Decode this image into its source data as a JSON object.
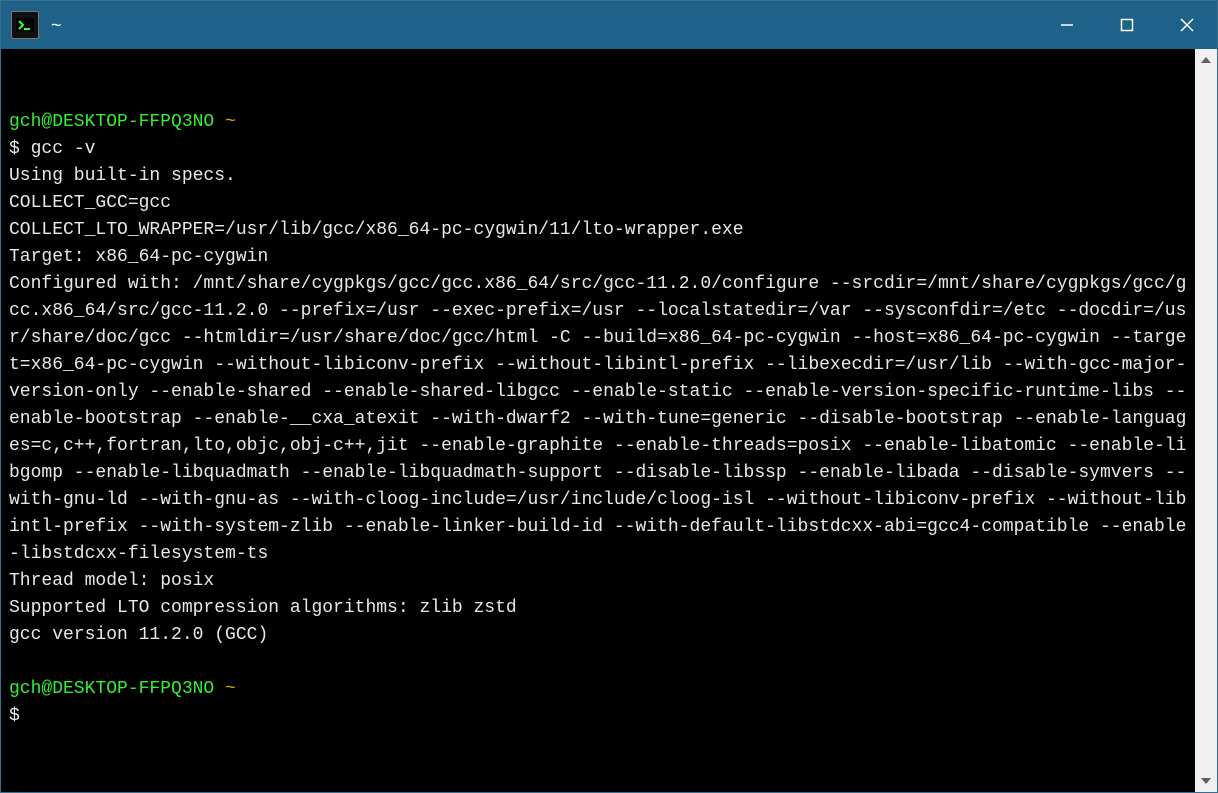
{
  "window": {
    "title": "~"
  },
  "terminal": {
    "prompt1_user": "gch@DESKTOP-FFPQ3NO",
    "prompt1_tilde": "~",
    "prompt1_symbol": "$ ",
    "command1": "gcc -v",
    "output": "Using built-in specs.\nCOLLECT_GCC=gcc\nCOLLECT_LTO_WRAPPER=/usr/lib/gcc/x86_64-pc-cygwin/11/lto-wrapper.exe\nTarget: x86_64-pc-cygwin\nConfigured with: /mnt/share/cygpkgs/gcc/gcc.x86_64/src/gcc-11.2.0/configure --srcdir=/mnt/share/cygpkgs/gcc/gcc.x86_64/src/gcc-11.2.0 --prefix=/usr --exec-prefix=/usr --localstatedir=/var --sysconfdir=/etc --docdir=/usr/share/doc/gcc --htmldir=/usr/share/doc/gcc/html -C --build=x86_64-pc-cygwin --host=x86_64-pc-cygwin --target=x86_64-pc-cygwin --without-libiconv-prefix --without-libintl-prefix --libexecdir=/usr/lib --with-gcc-major-version-only --enable-shared --enable-shared-libgcc --enable-static --enable-version-specific-runtime-libs --enable-bootstrap --enable-__cxa_atexit --with-dwarf2 --with-tune=generic --disable-bootstrap --enable-languages=c,c++,fortran,lto,objc,obj-c++,jit --enable-graphite --enable-threads=posix --enable-libatomic --enable-libgomp --enable-libquadmath --enable-libquadmath-support --disable-libssp --enable-libada --disable-symvers --with-gnu-ld --with-gnu-as --with-cloog-include=/usr/include/cloog-isl --without-libiconv-prefix --without-libintl-prefix --with-system-zlib --enable-linker-build-id --with-default-libstdcxx-abi=gcc4-compatible --enable-libstdcxx-filesystem-ts\nThread model: posix\nSupported LTO compression algorithms: zlib zstd\ngcc version 11.2.0 (GCC)\n",
    "prompt2_user": "gch@DESKTOP-FFPQ3NO",
    "prompt2_tilde": "~",
    "prompt2_symbol": "$ "
  }
}
